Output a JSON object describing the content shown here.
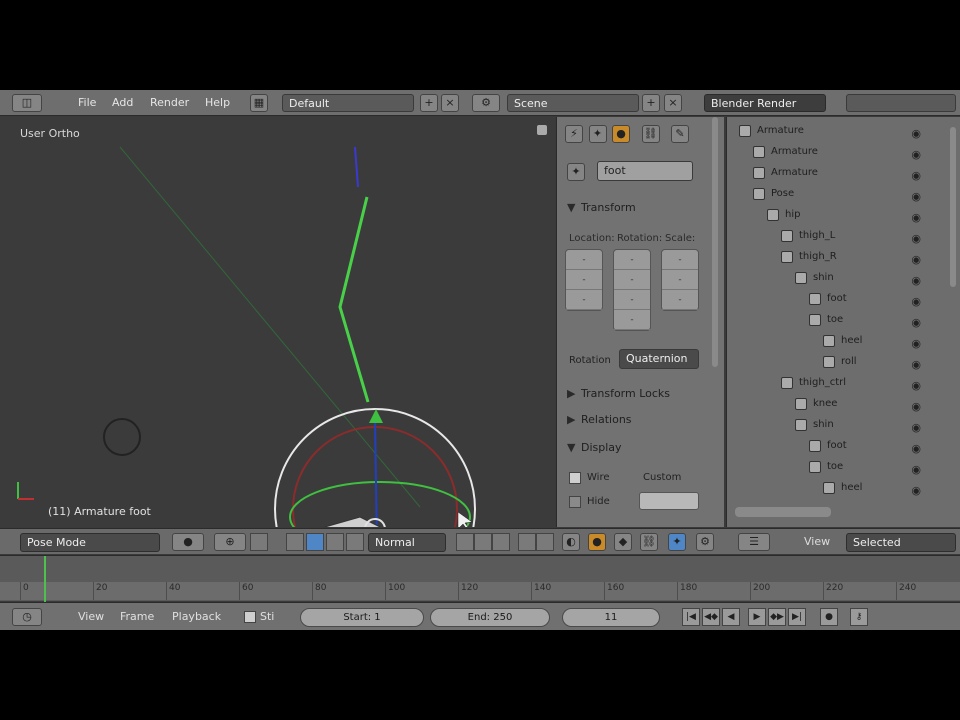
{
  "topbar": {
    "menus": [
      "File",
      "Add",
      "Render",
      "Help"
    ],
    "layout": "Default",
    "scene": "Scene",
    "engine": "Blender Render"
  },
  "viewport": {
    "title": "User Ortho",
    "status": "(11) Armature foot"
  },
  "properties": {
    "bone_name": "foot",
    "transform_label": "Transform",
    "columns": [
      "Location:",
      "Rotation:",
      "Scale:"
    ],
    "rotation_mode_label": "Rotation",
    "rotation_mode": "Quaternion",
    "sections": [
      "Transform Locks",
      "Relations",
      "Display"
    ],
    "display_wire": "Wire",
    "display_hide": "Hide",
    "display_custom": "Custom"
  },
  "outliner": {
    "rows": [
      {
        "label": "Armature",
        "indent": 0
      },
      {
        "label": "Armature",
        "indent": 1
      },
      {
        "label": "Armature",
        "indent": 1
      },
      {
        "label": "Pose",
        "indent": 1
      },
      {
        "label": "hip",
        "indent": 2
      },
      {
        "label": "thigh_L",
        "indent": 3
      },
      {
        "label": "thigh_R",
        "indent": 3
      },
      {
        "label": "shin",
        "indent": 4
      },
      {
        "label": "foot",
        "indent": 5
      },
      {
        "label": "toe",
        "indent": 5
      },
      {
        "label": "heel",
        "indent": 6
      },
      {
        "label": "roll",
        "indent": 6
      },
      {
        "label": "thigh_ctrl",
        "indent": 3
      },
      {
        "label": "knee",
        "indent": 4
      },
      {
        "label": "shin",
        "indent": 4
      },
      {
        "label": "foot",
        "indent": 5
      },
      {
        "label": "toe",
        "indent": 5
      },
      {
        "label": "heel",
        "indent": 6
      }
    ]
  },
  "header": {
    "mode": "Pose Mode",
    "orientation": "Normal",
    "view_label": "View",
    "filter": "Selected"
  },
  "timeline": {
    "ticks": [
      "0",
      "20",
      "40",
      "60",
      "80",
      "100",
      "120",
      "140",
      "160",
      "180",
      "200",
      "220",
      "240"
    ]
  },
  "bottombar": {
    "menus": [
      "View",
      "Frame",
      "Playback"
    ],
    "sync_label": "Sti",
    "start": "Start: 1",
    "end": "End: 250",
    "current": "11"
  }
}
